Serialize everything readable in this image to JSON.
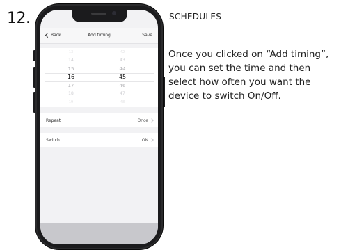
{
  "step_number": "12.",
  "section_title": "SCHEDULES",
  "description": "Once you clicked on “Add timing”, you can set the time and then select how often you want the device to switch On/Off.",
  "app": {
    "nav": {
      "back_label": "Back",
      "title": "Add timing",
      "save_label": "Save"
    },
    "picker": {
      "hours": [
        "13",
        "14",
        "15",
        "16",
        "17",
        "18",
        "19"
      ],
      "minutes": [
        "42",
        "43",
        "44",
        "45",
        "46",
        "47",
        "48"
      ]
    },
    "settings": [
      {
        "label": "Repeat",
        "value": "Once"
      },
      {
        "label": "Switch",
        "value": "ON"
      }
    ]
  }
}
